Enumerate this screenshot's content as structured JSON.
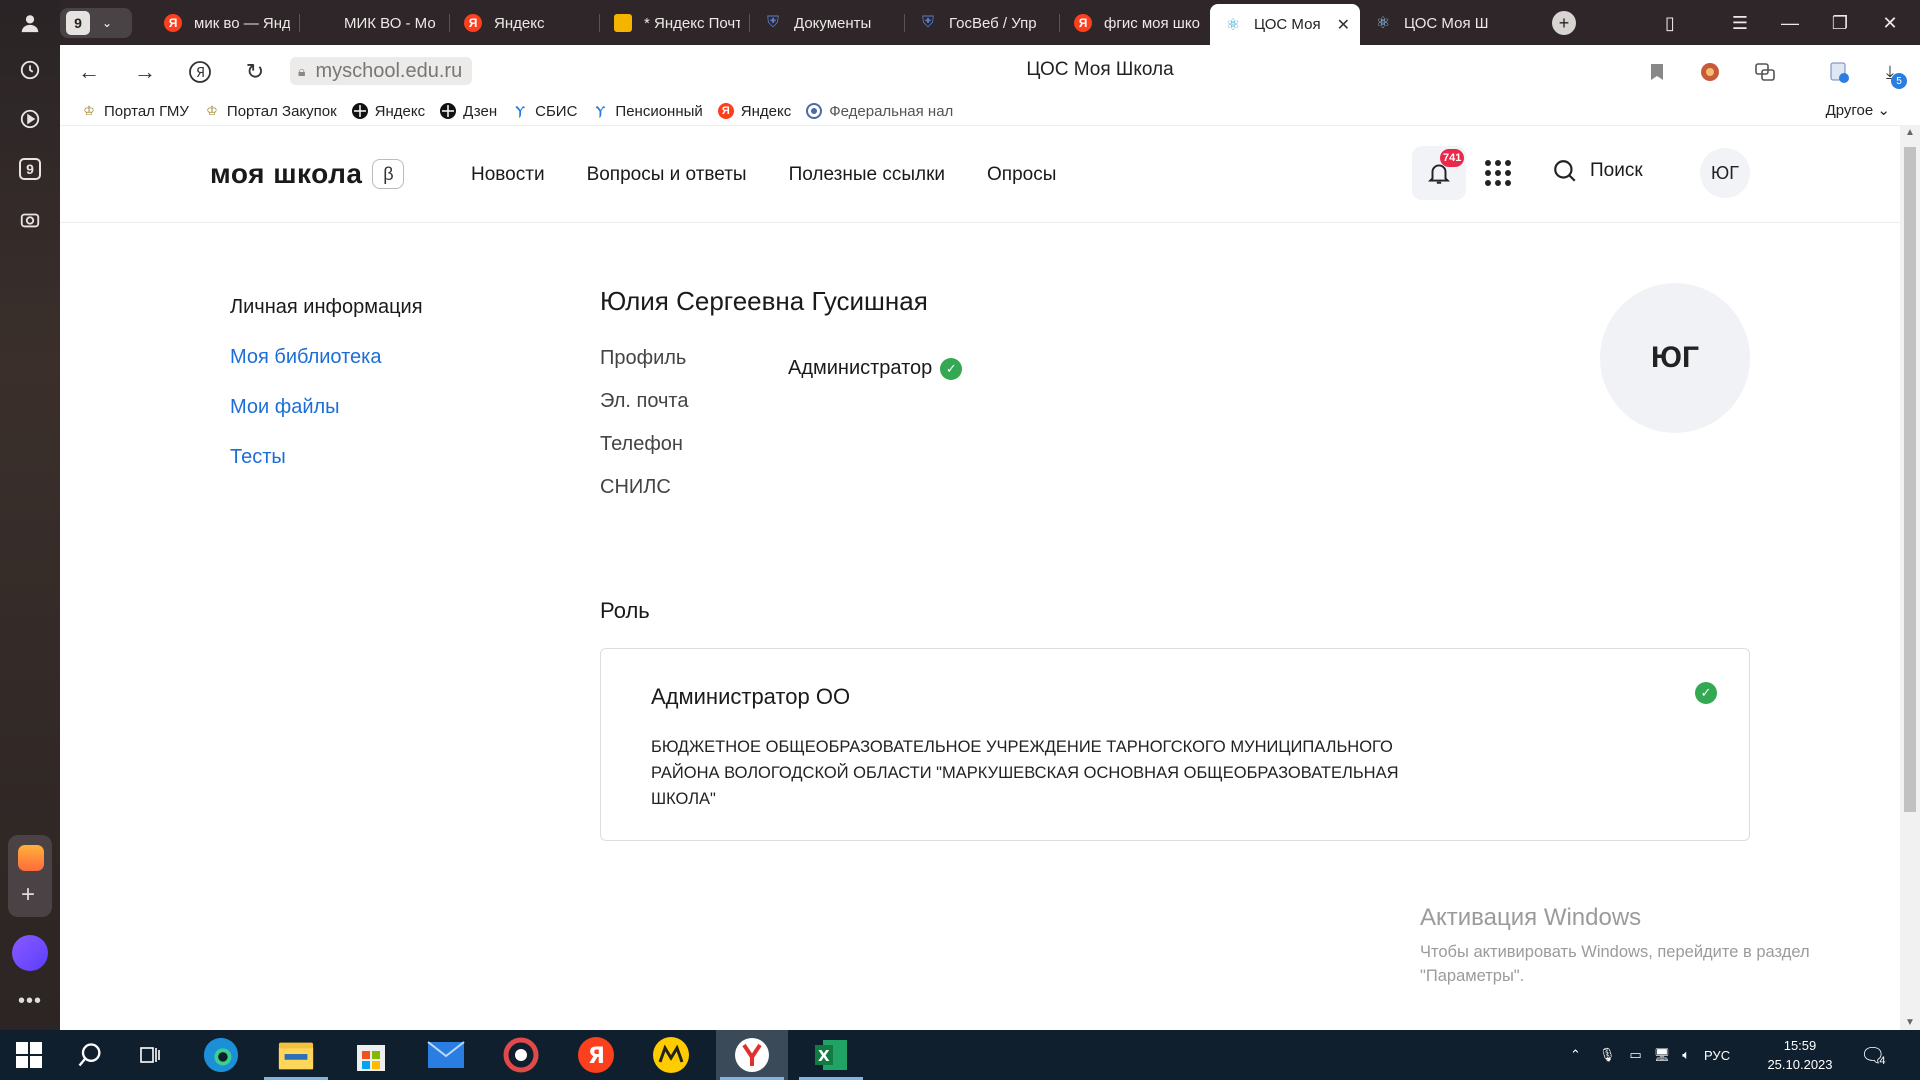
{
  "browser": {
    "tab_count": "9",
    "tabs": [
      {
        "title": "мик во — Янд",
        "icon": "yandex-icon"
      },
      {
        "title": "МИК ВО - Мо",
        "icon": "none"
      },
      {
        "title": "Яндекс",
        "icon": "yandex-icon"
      },
      {
        "title": "* Яндекс Почт",
        "icon": "mail-icon"
      },
      {
        "title": "Документы",
        "icon": "gosweb-icon"
      },
      {
        "title": "ГосВеб / Упр",
        "icon": "gosweb-icon"
      },
      {
        "title": "фгис моя шко",
        "icon": "yandex-icon"
      },
      {
        "title": "ЦОС Моя",
        "icon": "react-icon",
        "active": true
      },
      {
        "title": "ЦОС Моя Ш",
        "icon": "react-icon"
      }
    ],
    "url": "myschool.edu.ru",
    "page_title": "ЦОС Моя Школа",
    "downloads_count": "5",
    "bookmarks": [
      {
        "label": "Портал ГМУ",
        "icon": "emblem-icon"
      },
      {
        "label": "Портал Закупок",
        "icon": "emblem-icon"
      },
      {
        "label": "Яндекс",
        "icon": "zen-icon"
      },
      {
        "label": "Дзен",
        "icon": "zen-icon"
      },
      {
        "label": "СБИС",
        "icon": "sbis-icon"
      },
      {
        "label": "Пенсионный",
        "icon": "sbis-icon"
      },
      {
        "label": "Яндекс",
        "icon": "yandex-icon"
      },
      {
        "label": "Федеральная нал",
        "icon": "tax-icon"
      }
    ],
    "bookmarks_other": "Другое"
  },
  "site": {
    "logo": "моя школа",
    "beta": "β",
    "nav": [
      "Новости",
      "Вопросы и ответы",
      "Полезные ссылки",
      "Опросы"
    ],
    "notifications_badge": "741",
    "search_label": "Поиск",
    "user_initials": "ЮГ"
  },
  "sidebar": {
    "items": [
      {
        "label": "Личная информация",
        "current": true
      },
      {
        "label": "Моя библиотека"
      },
      {
        "label": "Мои файлы"
      },
      {
        "label": "Тесты"
      }
    ]
  },
  "profile": {
    "full_name": "Юлия Сергеевна Гусишная",
    "rows": [
      {
        "label": "Профиль",
        "value": "Администратор",
        "verified": true
      },
      {
        "label": "Эл. почта",
        "value": ""
      },
      {
        "label": "Телефон",
        "value": ""
      },
      {
        "label": "СНИЛС",
        "value": ""
      }
    ],
    "avatar_initials": "ЮГ"
  },
  "role": {
    "heading": "Роль",
    "title": "Администратор ОО",
    "organization": "БЮДЖЕТНОЕ ОБЩЕОБРАЗОВАТЕЛЬНОЕ УЧРЕЖДЕНИЕ ТАРНОГСКОГО МУНИЦИПАЛЬНОГО РАЙОНА ВОЛОГОДСКОЙ ОБЛАСТИ \"МАРКУШЕВСКАЯ ОСНОВНАЯ ОБЩЕОБРАЗОВАТЕЛЬНАЯ ШКОЛА\""
  },
  "watermark": {
    "title": "Активация Windows",
    "text": "Чтобы активировать Windows, перейдите в раздел \"Параметры\"."
  },
  "taskbar": {
    "language": "РУС",
    "time": "15:59",
    "date": "25.10.2023",
    "notifications": "4"
  },
  "colors": {
    "accent_link": "#1c6ed6",
    "verified_green": "#34a853",
    "badge_red": "#e8294a",
    "taskbar": "#0f1f2e"
  }
}
